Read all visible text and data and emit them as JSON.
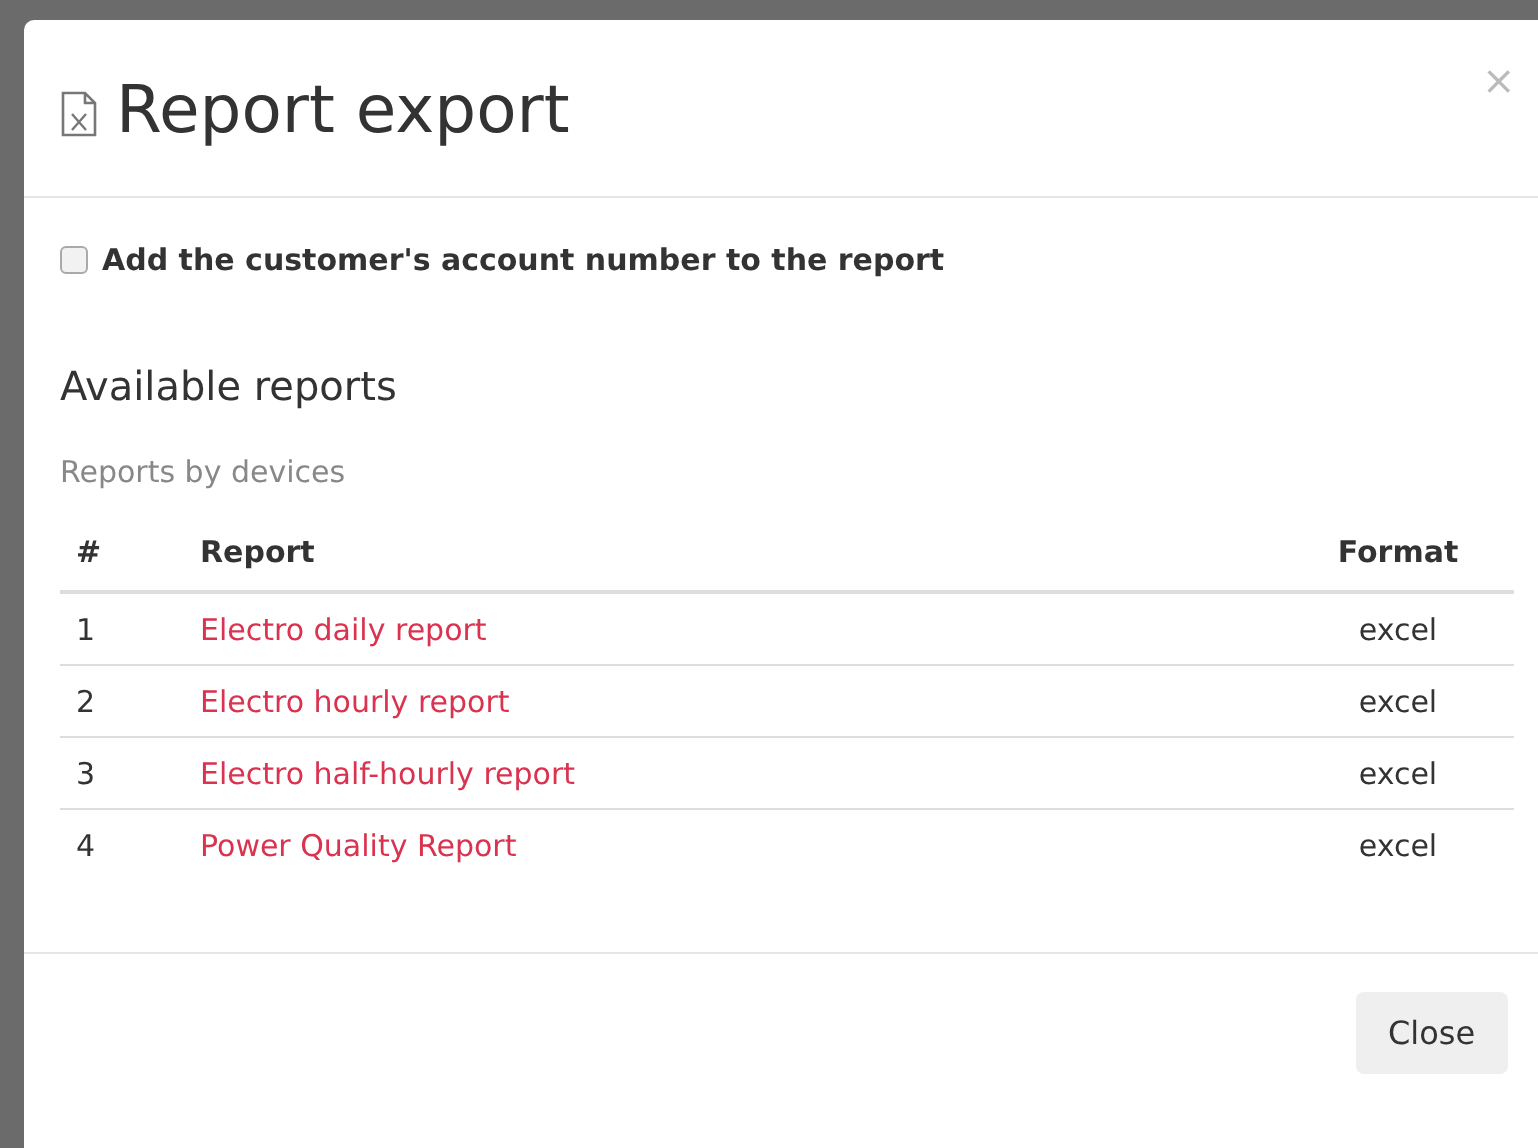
{
  "modal": {
    "title": "Report export",
    "close_glyph": "×"
  },
  "option": {
    "label": "Add the customer's account number to the report",
    "checked": false
  },
  "section_title": "Available reports",
  "group_title": "Reports by devices",
  "table": {
    "columns": [
      "#",
      "Report",
      "Format"
    ],
    "rows": [
      {
        "number": "1",
        "report": "Electro daily report",
        "format": "excel"
      },
      {
        "number": "2",
        "report": "Electro hourly report",
        "format": "excel"
      },
      {
        "number": "3",
        "report": "Electro half-hourly report",
        "format": "excel"
      },
      {
        "number": "4",
        "report": "Power Quality Report",
        "format": "excel"
      }
    ]
  },
  "buttons": [
    "Close"
  ]
}
